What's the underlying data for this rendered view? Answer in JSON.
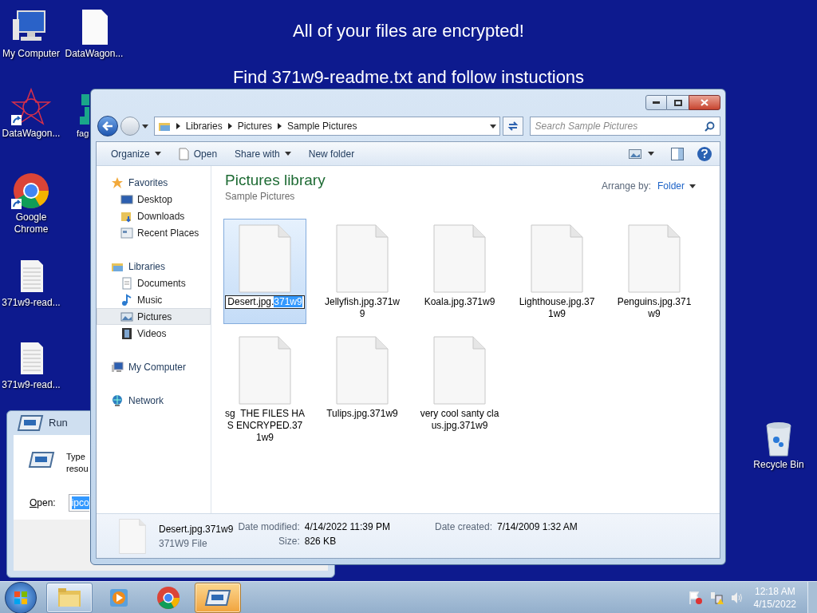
{
  "desktop": {
    "banner": [
      "All of your files are encrypted!",
      "Find 371w9-readme.txt and follow instuctions"
    ],
    "icons": [
      {
        "label": "My Computer",
        "kind": "computer",
        "shortcut": false
      },
      {
        "label": "DataWagon...",
        "kind": "file",
        "shortcut": false
      },
      {
        "label": "DataWagon...",
        "kind": "star",
        "shortcut": true
      },
      {
        "label": "fag",
        "kind": "app",
        "shortcut": false
      },
      {
        "label": "Google Chrome",
        "kind": "chrome",
        "shortcut": true
      },
      {
        "label": "371w9-read...",
        "kind": "text",
        "shortcut": false
      },
      {
        "label": "371w9-read...",
        "kind": "text",
        "shortcut": false
      },
      {
        "label": "Recycle Bin",
        "kind": "bin",
        "shortcut": false
      }
    ]
  },
  "run_dialog": {
    "title": "Run",
    "description_lines": [
      "Type",
      "resou"
    ],
    "open_label": "Open:",
    "value": "ipco"
  },
  "explorer": {
    "breadcrumb": [
      "Libraries",
      "Pictures",
      "Sample Pictures"
    ],
    "search": {
      "placeholder": "Search Sample Pictures"
    },
    "toolbar": [
      {
        "label": "Organize",
        "kind": "menu"
      },
      {
        "label": "Open",
        "kind": "open"
      },
      {
        "label": "Share with",
        "kind": "menu"
      },
      {
        "label": "New folder",
        "kind": "plain"
      }
    ],
    "nav": [
      {
        "label": "Favorites",
        "kind": "star",
        "selected": false,
        "children": [
          {
            "label": "Desktop",
            "kind": "desktop",
            "selected": false
          },
          {
            "label": "Downloads",
            "kind": "downloads",
            "selected": false
          },
          {
            "label": "Recent Places",
            "kind": "recent",
            "selected": false
          }
        ]
      },
      {
        "label": "Libraries",
        "kind": "library",
        "selected": false,
        "children": [
          {
            "label": "Documents",
            "kind": "documents",
            "selected": false
          },
          {
            "label": "Music",
            "kind": "music",
            "selected": false
          },
          {
            "label": "Pictures",
            "kind": "pictures",
            "selected": true
          },
          {
            "label": "Videos",
            "kind": "videos",
            "selected": false
          }
        ]
      },
      {
        "label": "My Computer",
        "kind": "computer",
        "selected": false
      },
      {
        "label": "Network",
        "kind": "network",
        "selected": false
      }
    ],
    "heading": "Pictures library",
    "subheading": "Sample Pictures",
    "arrange_label": "Arrange by:",
    "arrange_value": "Folder",
    "files": [
      {
        "selected": true,
        "rename": {
          "value": "Desert.jpg.",
          "selection": "371w9"
        }
      },
      {
        "name": "Jellyfish.jpg.371w9",
        "selected": false
      },
      {
        "name": "Koala.jpg.371w9",
        "selected": false
      },
      {
        "name": "Lighthouse.jpg.371w9",
        "selected": false
      },
      {
        "name": "Penguins.jpg.371w9",
        "selected": false
      },
      {
        "name": "sg  THE FILES HAS ENCRYPED.371w9",
        "selected": false
      },
      {
        "name": "Tulips.jpg.371w9",
        "selected": false
      },
      {
        "name": "very cool santy claus.jpg.371w9",
        "selected": false
      }
    ],
    "details": {
      "name": "Desert.jpg.371w9",
      "type": "371W9 File",
      "fields": [
        {
          "label": "Date modified:",
          "value": "4/14/2022 11:39 PM"
        },
        {
          "label": "Size:",
          "value": "826 KB"
        },
        {
          "label": "Date created:",
          "value": "7/14/2009 1:32 AM"
        }
      ]
    }
  },
  "taskbar": {
    "items": [
      {
        "kind": "explorer",
        "open": true,
        "active": false
      },
      {
        "kind": "media",
        "open": false,
        "active": false
      },
      {
        "kind": "chrome",
        "open": false,
        "active": false
      },
      {
        "kind": "run",
        "open": true,
        "active": true
      }
    ],
    "tray": [
      {
        "kind": "flag"
      },
      {
        "kind": "network"
      },
      {
        "kind": "volume"
      }
    ],
    "time": "12:18 AM",
    "date": "4/15/2022"
  }
}
